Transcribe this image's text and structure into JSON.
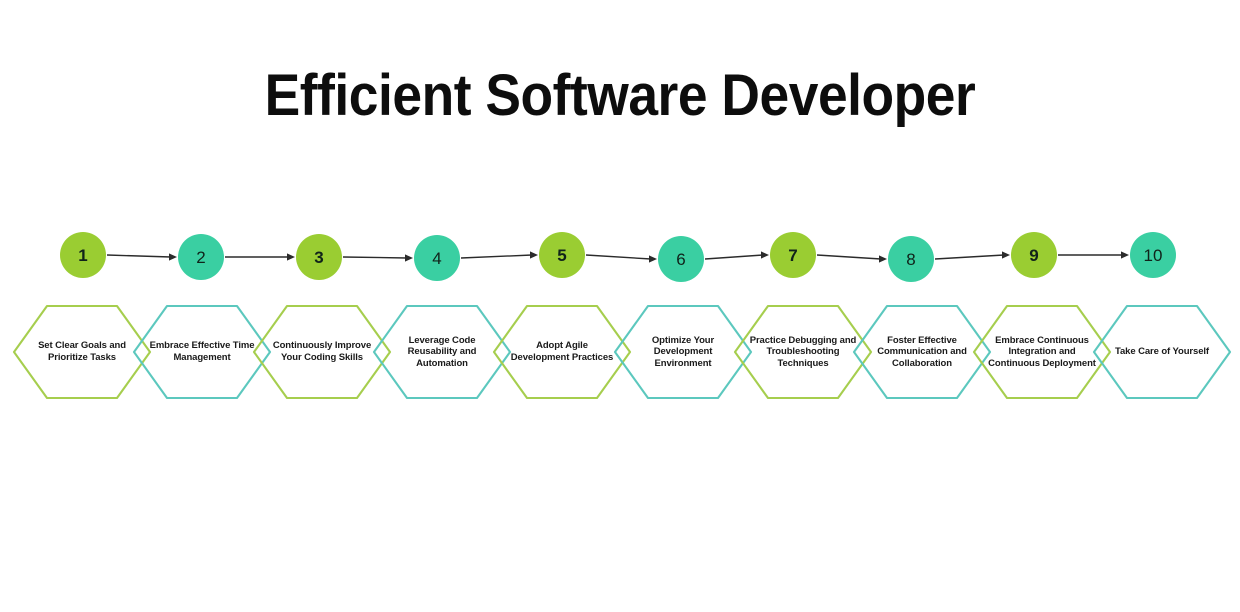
{
  "page": {
    "title": "Efficient Software Developer",
    "background_color": "#ffffff"
  },
  "colors": {
    "green_fill": "#9ACD32",
    "teal_fill": "#3ACFA2",
    "green_stroke": "#A6CE4E",
    "teal_stroke": "#5CC8BE",
    "arrow": "#2b2b2b",
    "text": "#1a1a1a"
  },
  "chart_data": {
    "type": "diagram",
    "title": "Efficient Software Developer",
    "layout": "horizontal numbered flow with hexagon captions",
    "step_count": 10,
    "steps": [
      {
        "number": "1",
        "label": "Set Clear Goals and Prioritize Tasks",
        "color": "green"
      },
      {
        "number": "2",
        "label": "Embrace Effective Time Management",
        "color": "teal"
      },
      {
        "number": "3",
        "label": "Continuously Improve Your Coding Skills",
        "color": "green"
      },
      {
        "number": "4",
        "label": "Leverage Code Reusability and Automation",
        "color": "teal"
      },
      {
        "number": "5",
        "label": "Adopt Agile Development Practices",
        "color": "green"
      },
      {
        "number": "6",
        "label": "Optimize Your Development Environment",
        "color": "teal"
      },
      {
        "number": "7",
        "label": "Practice Debugging and Troubleshooting Techniques",
        "color": "green"
      },
      {
        "number": "8",
        "label": "Foster Effective Communication and Collaboration",
        "color": "teal"
      },
      {
        "number": "9",
        "label": "Embrace Continuous Integration and Continuous Deployment",
        "color": "green"
      },
      {
        "number": "10",
        "label": "Take Care of Yourself",
        "color": "teal"
      }
    ]
  }
}
